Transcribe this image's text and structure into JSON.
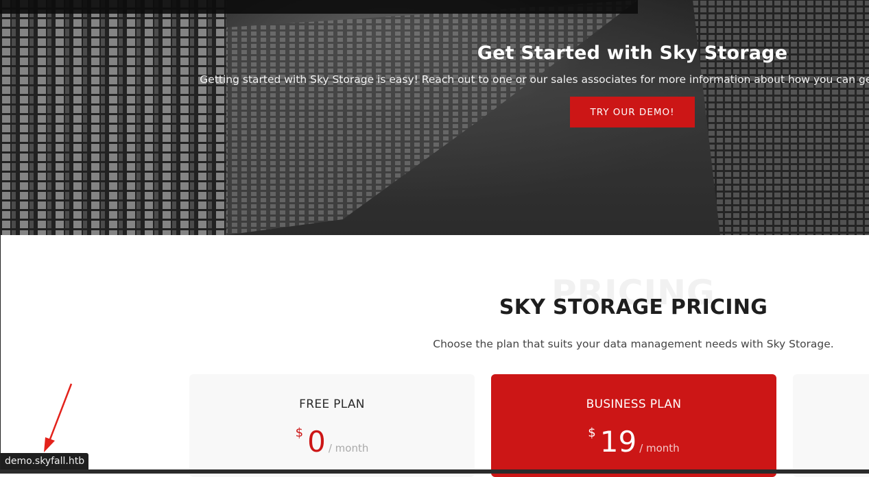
{
  "hero": {
    "title": "Get Started with Sky Storage",
    "text": "Getting started with Sky Storage is easy! Reach out to one or our sales associates for more information about how you can get started or log in to our portal here.",
    "button_label": "TRY OUR DEMO!"
  },
  "pricing": {
    "background_word": "PRICING",
    "title": "SKY STORAGE PRICING",
    "subtitle": "Choose the plan that suits your data management needs with Sky Storage.",
    "plans": [
      {
        "name": "FREE PLAN",
        "currency": "$",
        "amount": "0",
        "period": "/ month"
      },
      {
        "name": "BUSINESS PLAN",
        "currency": "$",
        "amount": "19",
        "period": "/ month"
      }
    ]
  },
  "status_bar": {
    "url": "demo.skyfall.htb"
  },
  "colors": {
    "accent": "#cc1616",
    "hero_overlay": "#3a3a3a",
    "card_bg": "#f8f8f8",
    "annotation_arrow": "#e3221b"
  }
}
